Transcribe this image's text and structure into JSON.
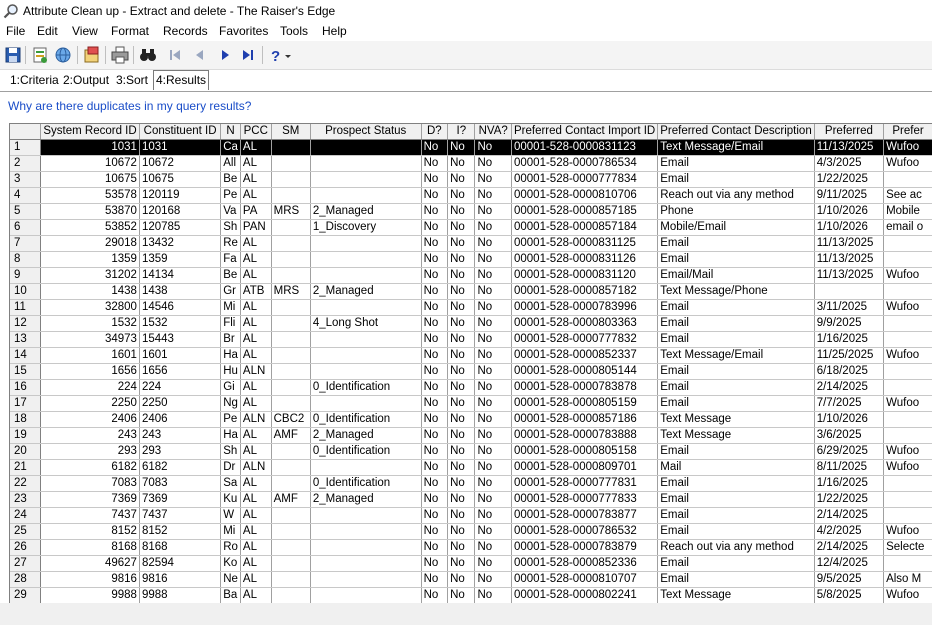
{
  "window": {
    "title": "Attribute Clean up - Extract and delete - The Raiser's Edge"
  },
  "menu": [
    "File",
    "Edit",
    "View",
    "Format",
    "Records",
    "Favorites",
    "Tools",
    "Help"
  ],
  "toolbar": {
    "icons": [
      "save-icon",
      "properties-icon",
      "web-icon",
      "export-icon",
      "print-icon",
      "binoculars-icon",
      "first-record-icon",
      "previous-record-icon",
      "next-record-icon",
      "last-record-icon",
      "help-icon",
      "dropdown-arrow-icon"
    ]
  },
  "tabs": [
    {
      "key": "1",
      "label": "1:Criteria",
      "active": false
    },
    {
      "key": "2",
      "label": "2:Output",
      "active": false
    },
    {
      "key": "3",
      "label": "3:Sort",
      "active": false
    },
    {
      "key": "4",
      "label": "4:Results",
      "active": true
    }
  ],
  "help_link": "Why are there duplicates in my query results?",
  "grid": {
    "columns": [
      "",
      "System Record ID",
      "Constituent ID",
      "N",
      "PCC",
      "SM",
      "Prospect Status",
      "D?",
      "I?",
      "NVA?",
      "Preferred Contact Import ID",
      "Preferred Contact Description",
      "Preferred",
      "Prefer"
    ],
    "rows": [
      [
        "1",
        "1031",
        "1031",
        "Ca",
        "AL",
        "",
        "",
        "No",
        "No",
        "No",
        "00001-528-0000831123",
        "Text Message/Email",
        "11/13/2025",
        "Wufoo"
      ],
      [
        "2",
        "10672",
        "10672",
        "All",
        "AL",
        "",
        "",
        "No",
        "No",
        "No",
        "00001-528-0000786534",
        "Email",
        "4/3/2025",
        "Wufoo"
      ],
      [
        "3",
        "10675",
        "10675",
        "Be",
        "AL",
        "",
        "",
        "No",
        "No",
        "No",
        "00001-528-0000777834",
        "Email",
        "1/22/2025",
        ""
      ],
      [
        "4",
        "53578",
        "120119",
        "Pe",
        "AL",
        "",
        "",
        "No",
        "No",
        "No",
        "00001-528-0000810706",
        "Reach out via any method",
        "9/11/2025",
        "See ac"
      ],
      [
        "5",
        "53870",
        "120168",
        "Va",
        "PA",
        "MRS",
        "2_Managed",
        "No",
        "No",
        "No",
        "00001-528-0000857185",
        "Phone",
        "1/10/2026",
        "Mobile"
      ],
      [
        "6",
        "53852",
        "120785",
        "Sh",
        "PAN",
        "",
        "1_Discovery",
        "No",
        "No",
        "No",
        "00001-528-0000857184",
        "Mobile/Email",
        "1/10/2026",
        "email o"
      ],
      [
        "7",
        "29018",
        "13432",
        "Re",
        "AL",
        "",
        "",
        "No",
        "No",
        "No",
        "00001-528-0000831125",
        "Email",
        "11/13/2025",
        ""
      ],
      [
        "8",
        "1359",
        "1359",
        "Fa",
        "AL",
        "",
        "",
        "No",
        "No",
        "No",
        "00001-528-0000831126",
        "Email",
        "11/13/2025",
        ""
      ],
      [
        "9",
        "31202",
        "14134",
        "Be",
        "AL",
        "",
        "",
        "No",
        "No",
        "No",
        "00001-528-0000831120",
        "Email/Mail",
        "11/13/2025",
        "Wufoo"
      ],
      [
        "10",
        "1438",
        "1438",
        "Gr",
        "ATB",
        "MRS",
        "2_Managed",
        "No",
        "No",
        "No",
        "00001-528-0000857182",
        "Text Message/Phone",
        "",
        ""
      ],
      [
        "11",
        "32800",
        "14546",
        "Mi",
        "AL",
        "",
        "",
        "No",
        "No",
        "No",
        "00001-528-0000783996",
        "Email",
        "3/11/2025",
        "Wufoo"
      ],
      [
        "12",
        "1532",
        "1532",
        "Fli",
        "AL",
        "",
        "4_Long Shot",
        "No",
        "No",
        "No",
        "00001-528-0000803363",
        "Email",
        "9/9/2025",
        ""
      ],
      [
        "13",
        "34973",
        "15443",
        "Br",
        "AL",
        "",
        "",
        "No",
        "No",
        "No",
        "00001-528-0000777832",
        "Email",
        "1/16/2025",
        ""
      ],
      [
        "14",
        "1601",
        "1601",
        "Ha",
        "AL",
        "",
        "",
        "No",
        "No",
        "No",
        "00001-528-0000852337",
        "Text Message/Email",
        "11/25/2025",
        "Wufoo"
      ],
      [
        "15",
        "1656",
        "1656",
        "Hu",
        "ALN",
        "",
        "",
        "No",
        "No",
        "No",
        "00001-528-0000805144",
        "Email",
        "6/18/2025",
        ""
      ],
      [
        "16",
        "224",
        "224",
        "Gi",
        "AL",
        "",
        "0_Identification",
        "No",
        "No",
        "No",
        "00001-528-0000783878",
        "Email",
        "2/14/2025",
        ""
      ],
      [
        "17",
        "2250",
        "2250",
        "Ng",
        "AL",
        "",
        "",
        "No",
        "No",
        "No",
        "00001-528-0000805159",
        "Email",
        "7/7/2025",
        "Wufoo"
      ],
      [
        "18",
        "2406",
        "2406",
        "Pe",
        "ALN",
        "CBC2",
        "0_Identification",
        "No",
        "No",
        "No",
        "00001-528-0000857186",
        "Text Message",
        "1/10/2026",
        ""
      ],
      [
        "19",
        "243",
        "243",
        "Ha",
        "AL",
        "AMF",
        "2_Managed",
        "No",
        "No",
        "No",
        "00001-528-0000783888",
        "Text Message",
        "3/6/2025",
        ""
      ],
      [
        "20",
        "293",
        "293",
        "Sh",
        "AL",
        "",
        "0_Identification",
        "No",
        "No",
        "No",
        "00001-528-0000805158",
        "Email",
        "6/29/2025",
        "Wufoo"
      ],
      [
        "21",
        "6182",
        "6182",
        "Dr",
        "ALN",
        "",
        "",
        "No",
        "No",
        "No",
        "00001-528-0000809701",
        "Mail",
        "8/11/2025",
        "Wufoo"
      ],
      [
        "22",
        "7083",
        "7083",
        "Sa",
        "AL",
        "",
        "0_Identification",
        "No",
        "No",
        "No",
        "00001-528-0000777831",
        "Email",
        "1/16/2025",
        ""
      ],
      [
        "23",
        "7369",
        "7369",
        "Ku",
        "AL",
        "AMF",
        "2_Managed",
        "No",
        "No",
        "No",
        "00001-528-0000777833",
        "Email",
        "1/22/2025",
        ""
      ],
      [
        "24",
        "7437",
        "7437",
        "W",
        "AL",
        "",
        "",
        "No",
        "No",
        "No",
        "00001-528-0000783877",
        "Email",
        "2/14/2025",
        ""
      ],
      [
        "25",
        "8152",
        "8152",
        "Mi",
        "AL",
        "",
        "",
        "No",
        "No",
        "No",
        "00001-528-0000786532",
        "Email",
        "4/2/2025",
        "Wufoo"
      ],
      [
        "26",
        "8168",
        "8168",
        "Ro",
        "AL",
        "",
        "",
        "No",
        "No",
        "No",
        "00001-528-0000783879",
        "Reach out via any method",
        "2/14/2025",
        "Selecte"
      ],
      [
        "27",
        "49627",
        "82594",
        "Ko",
        "AL",
        "",
        "",
        "No",
        "No",
        "No",
        "00001-528-0000852336",
        "Email",
        "12/4/2025",
        ""
      ],
      [
        "28",
        "9816",
        "9816",
        "Ne",
        "AL",
        "",
        "",
        "No",
        "No",
        "No",
        "00001-528-0000810707",
        "Email",
        "9/5/2025",
        "Also M"
      ],
      [
        "29",
        "9988",
        "9988",
        "Ba",
        "AL",
        "",
        "",
        "No",
        "No",
        "No",
        "00001-528-0000802241",
        "Text Message",
        "5/8/2025",
        "Wufoo"
      ]
    ],
    "selected_row": 0
  }
}
